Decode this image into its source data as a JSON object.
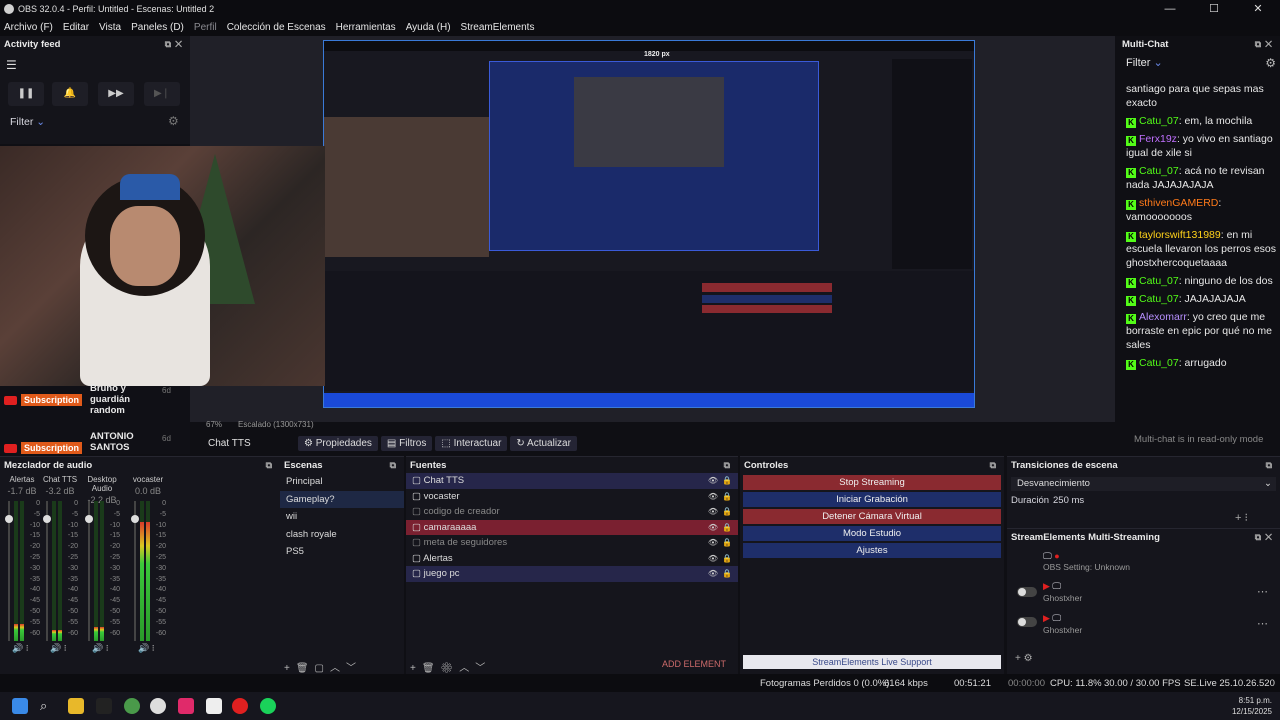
{
  "window": {
    "title": "OBS 32.0.4 - Perfil: Untitled - Escenas: Untitled 2",
    "controls": [
      "—",
      "☐",
      "✕"
    ]
  },
  "menu": [
    "Archivo (F)",
    "Editar",
    "Vista",
    "Paneles (D)",
    "Perfil",
    "Colección de Escenas",
    "Herramientas",
    "Ayuda (H)",
    "StreamElements"
  ],
  "activity": {
    "title": "Activity feed",
    "filter": "Filter"
  },
  "subs": [
    {
      "badge": "Subscription",
      "name": "Bruno y guardián random",
      "age": "6d"
    },
    {
      "badge": "Subscription",
      "name": "ANTONIO SANTOS",
      "age": "6d"
    }
  ],
  "capture": {
    "width_label": "1820 px"
  },
  "preview_status": {
    "zoom": "67%",
    "scale": "Escalado (1300x731)"
  },
  "source_toolbar": {
    "source": "Chat TTS",
    "buttons": [
      "Propiedades",
      "Filtros",
      "Interactuar",
      "Actualizar"
    ]
  },
  "multichat": {
    "title": "Multi-Chat",
    "filter": "Filter",
    "readonly": "Multi-chat is in read-only mode",
    "messages": [
      {
        "user": "",
        "text": "santiago para que sepas mas exacto",
        "color": "#e8e8e8",
        "badge": false
      },
      {
        "user": "Catu_07",
        "text": "em, la mochila",
        "color": "#53fc18",
        "badge": true
      },
      {
        "user": "Ferx19z",
        "text": "yo vivo en santiago igual de xile si",
        "color": "#c070ff",
        "badge": true
      },
      {
        "user": "Catu_07",
        "text": "acá no te revisan nada JAJAJAJAJA",
        "color": "#53fc18",
        "badge": true
      },
      {
        "user": "sthivenGAMERD",
        "text": "vamooooooos",
        "color": "#ff7a1a",
        "badge": true
      },
      {
        "user": "taylorswift131989",
        "text": "en mi escuela llevaron los perros esos ghostxhercoquetaaaa",
        "color": "#ffd21a",
        "badge": true
      },
      {
        "user": "Catu_07",
        "text": "ninguno de los dos",
        "color": "#53fc18",
        "badge": true
      },
      {
        "user": "Catu_07",
        "text": "JAJAJAJAJA",
        "color": "#53fc18",
        "badge": true
      },
      {
        "user": "Alexomarr",
        "text": "yo creo que me borraste en epic por qué no me sales",
        "color": "#b890ff",
        "badge": true
      },
      {
        "user": "Catu_07",
        "text": "arrugado",
        "color": "#53fc18",
        "badge": true
      }
    ]
  },
  "mixer": {
    "title": "Mezclador de audio",
    "channels": [
      {
        "name": "Alertas",
        "db": "-1.7 dB",
        "level": 0.12
      },
      {
        "name": "Chat TTS",
        "db": "-3.2 dB",
        "level": 0.08
      },
      {
        "name": "Desktop Audio",
        "db": "-2.2 dB",
        "level": 0.1
      },
      {
        "name": "vocaster",
        "db": "0.0 dB",
        "level": 0.85
      }
    ],
    "ticks": [
      "0",
      "-5",
      "-10",
      "-15",
      "-20",
      "-25",
      "-30",
      "-35",
      "-40",
      "-45",
      "-50",
      "-55",
      "-60"
    ]
  },
  "scenes": {
    "title": "Escenas",
    "items": [
      "Principal",
      "Gameplay?",
      "wii",
      "clash royale",
      "PS5"
    ],
    "selected": 1
  },
  "sources": {
    "title": "Fuentes",
    "items": [
      {
        "name": "Chat TTS",
        "style": "blue"
      },
      {
        "name": "vocaster",
        "style": ""
      },
      {
        "name": "codigo de creador",
        "style": "dim"
      },
      {
        "name": "camaraaaaa",
        "style": "red"
      },
      {
        "name": "meta de seguidores",
        "style": "dim"
      },
      {
        "name": "Alertas",
        "style": ""
      },
      {
        "name": "juego pc",
        "style": "blue"
      }
    ],
    "add_element": "ADD ELEMENT"
  },
  "controls": {
    "title": "Controles",
    "buttons": [
      {
        "label": "Stop Streaming",
        "style": "red"
      },
      {
        "label": "Iniciar Grabación",
        "style": ""
      },
      {
        "label": "Detener Cámara Virtual",
        "style": "red"
      },
      {
        "label": "Modo Estudio",
        "style": ""
      },
      {
        "label": "Ajustes",
        "style": ""
      }
    ],
    "support": "StreamElements Live Support"
  },
  "transitions": {
    "title": "Transiciones de escena",
    "selected": "Desvanecimiento",
    "duration_label": "Duración",
    "duration": "250 ms"
  },
  "multistream": {
    "title": "StreamElements Multi-Streaming",
    "rows": [
      "OBS Setting: Unknown",
      "Ghostxher",
      "Ghostxher"
    ]
  },
  "status": {
    "dropped": "Fotogramas Perdidos 0 (0.0%)",
    "kbps": "6164 kbps",
    "live": "00:51:21",
    "rec": "00:00:00",
    "cpu": "CPU: 11.8%",
    "fps": "30.00 / 30.00 FPS",
    "se": "SE.Live 25.10.26.520"
  },
  "clock": {
    "time": "8:51 p.m.",
    "date": "12/15/2025"
  },
  "colors": {
    "accent_red": "#8a2a30",
    "accent_blue": "#1e2e6a",
    "kick_green": "#53fc18"
  }
}
